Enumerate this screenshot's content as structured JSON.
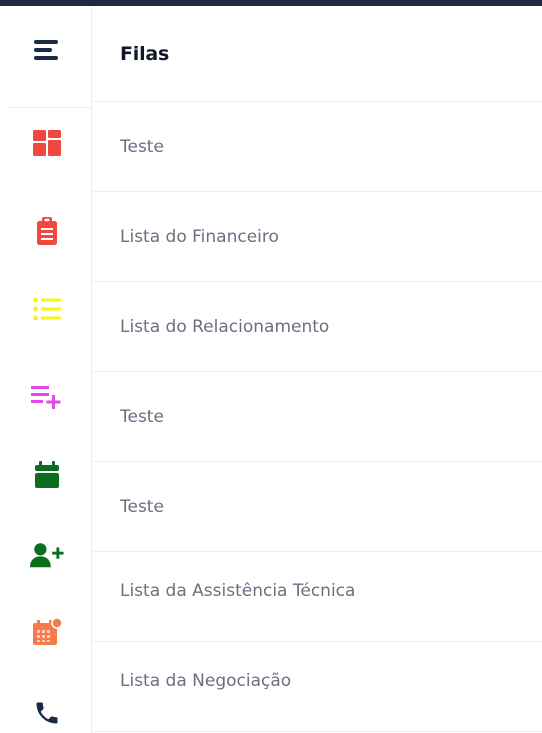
{
  "header": {
    "title": "Filas"
  },
  "queues": [
    {
      "label": "Teste"
    },
    {
      "label": "Lista do Financeiro"
    },
    {
      "label": "Lista do Relacionamento"
    },
    {
      "label": "Teste"
    },
    {
      "label": "Teste"
    },
    {
      "label": "Lista da Assistência Técnica"
    },
    {
      "label": "Lista da Negociação"
    }
  ],
  "rail_icons": [
    {
      "icon": "menu-icon",
      "color": "#1b2a45"
    },
    {
      "icon": "dashboard-icon",
      "color": "#f0473e"
    },
    {
      "icon": "clipboard-icon",
      "color": "#f0473e"
    },
    {
      "icon": "list-icon",
      "color": "#f5f51a"
    },
    {
      "icon": "playlist-add-icon",
      "color": "#e24ae8"
    },
    {
      "icon": "calendar-icon",
      "color": "#0a6e1c"
    },
    {
      "icon": "user-add-icon",
      "color": "#0a6e1c"
    },
    {
      "icon": "calendar-notification-icon",
      "color": "#f57a4c"
    },
    {
      "icon": "phone-icon",
      "color": "#1b2a45"
    }
  ]
}
